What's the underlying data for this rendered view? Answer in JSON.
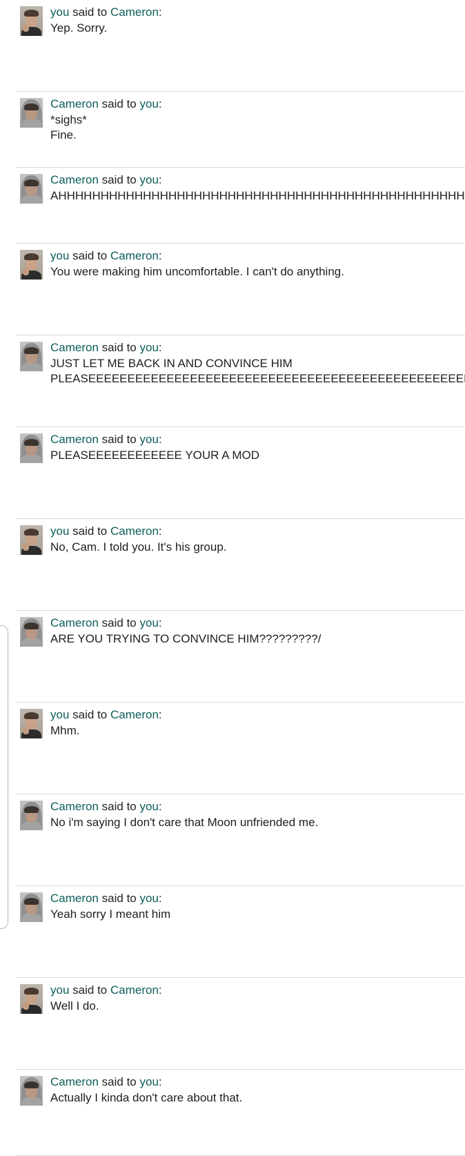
{
  "phrases": {
    "said_to": "said to",
    "colon": ":"
  },
  "messages": [
    {
      "from": "you",
      "to": "Cameron",
      "avatar": "avatar-you-icon",
      "lines": [
        "Yep. Sorry."
      ]
    },
    {
      "from": "Cameron",
      "to": "you",
      "avatar": "avatar-cameron-icon",
      "lines": [
        "*sighs*",
        "Fine."
      ]
    },
    {
      "from": "Cameron",
      "to": "you",
      "avatar": "avatar-cameron-icon",
      "lines": [
        "AHHHHHHHHHHHHHHHHHHHHHHHHHHHHHHHHHHHHHHHHHHHHHHHHH"
      ]
    },
    {
      "from": "you",
      "to": "Cameron",
      "avatar": "avatar-you-icon",
      "lines": [
        "You were making him uncomfortable. I can't do anything."
      ]
    },
    {
      "from": "Cameron",
      "to": "you",
      "avatar": "avatar-cameron-icon",
      "lines": [
        "JUST LET ME BACK IN AND CONVINCE HIM",
        "PLEASEEEEEEEEEEEEEEEEEEEEEEEEEEEEEEEEEEEEEEEEEEEEEEEEEEEEEEE"
      ]
    },
    {
      "from": "Cameron",
      "to": "you",
      "avatar": "avatar-cameron-icon",
      "lines": [
        "PLEASEEEEEEEEEEEE YOUR A MOD"
      ]
    },
    {
      "from": "you",
      "to": "Cameron",
      "avatar": "avatar-you-icon",
      "lines": [
        "No, Cam. I told you. It's his group."
      ]
    },
    {
      "from": "Cameron",
      "to": "you",
      "avatar": "avatar-cameron-icon",
      "lines": [
        "ARE YOU TRYING TO CONVINCE HIM?????????/"
      ]
    },
    {
      "from": "you",
      "to": "Cameron",
      "avatar": "avatar-you-icon",
      "lines": [
        "Mhm."
      ]
    },
    {
      "from": "Cameron",
      "to": "you",
      "avatar": "avatar-cameron-icon",
      "lines": [
        "No i'm saying I don't care that Moon unfriended me."
      ]
    },
    {
      "from": "Cameron",
      "to": "you",
      "avatar": "avatar-cameron-icon",
      "lines": [
        "Yeah sorry I meant him"
      ]
    },
    {
      "from": "you",
      "to": "Cameron",
      "avatar": "avatar-you-icon",
      "lines": [
        "Well I do."
      ]
    },
    {
      "from": "Cameron",
      "to": "you",
      "avatar": "avatar-cameron-icon",
      "lines": [
        "Actually I kinda don't care about that."
      ]
    }
  ]
}
